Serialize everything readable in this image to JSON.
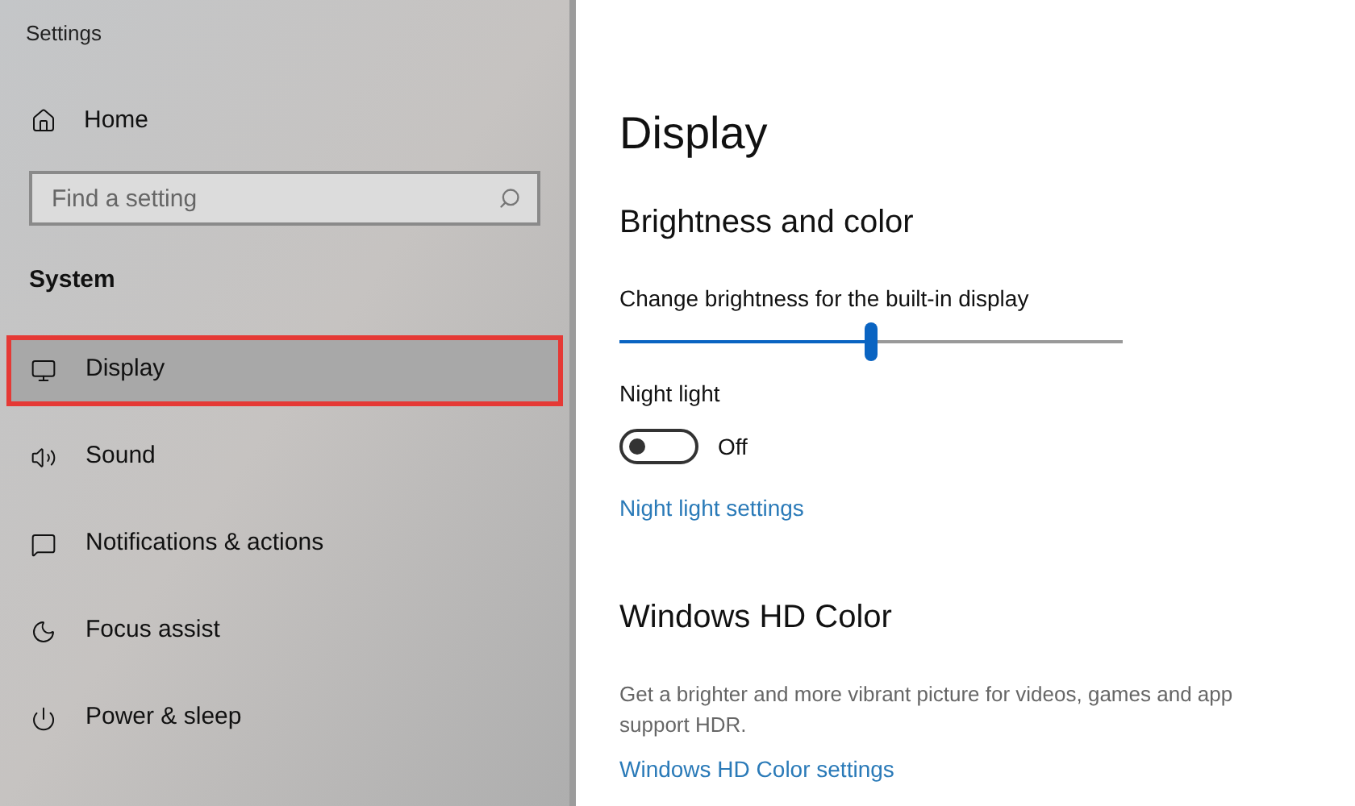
{
  "window": {
    "title": "Settings"
  },
  "sidebar": {
    "home": {
      "label": "Home"
    },
    "search": {
      "placeholder": "Find a setting"
    },
    "section": "System",
    "items": [
      {
        "label": "Display",
        "selected": true
      },
      {
        "label": "Sound",
        "selected": false
      },
      {
        "label": "Notifications & actions",
        "selected": false
      },
      {
        "label": "Focus assist",
        "selected": false
      },
      {
        "label": "Power & sleep",
        "selected": false
      }
    ]
  },
  "page": {
    "title": "Display",
    "section": "Brightness and color",
    "brightness": {
      "label": "Change brightness for the built-in display",
      "level": 0.5
    },
    "night_light": {
      "label": "Night light",
      "on": false,
      "state_text": "Off"
    },
    "night_light_link": "Night light settings",
    "hd_section": "Windows HD Color",
    "hd_description": [
      "Get a brighter and more vibrant picture for videos, games and app",
      "support HDR."
    ],
    "hd_link": "Windows HD Color settings"
  }
}
